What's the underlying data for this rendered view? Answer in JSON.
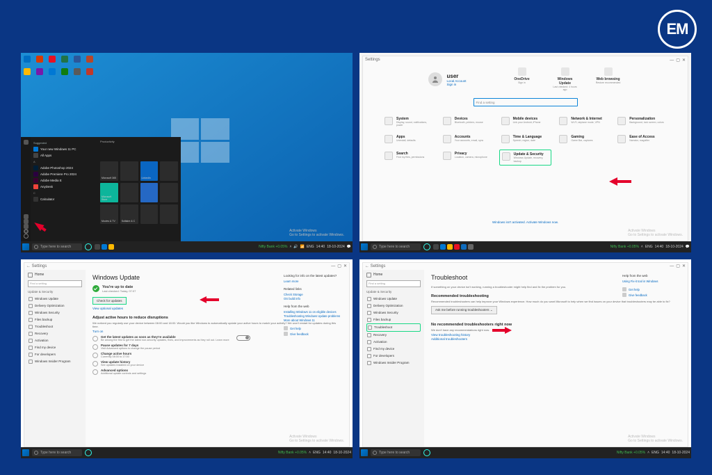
{
  "brand": "EM",
  "common": {
    "search_placeholder": "Type here to search",
    "activate_title": "Activate Windows",
    "activate_sub": "Go to Settings to activate Windows.",
    "clock": "14:40",
    "date": "18-10-2024",
    "stock": "Nifty Bank +0.05%"
  },
  "p1": {
    "desktop_icons": [
      "#006fc4",
      "#d83b01",
      "#e81123",
      "#217346",
      "#2b579a",
      "#b7472a",
      "#ffb900",
      "#7719aa",
      "#0078d4",
      "#107c10",
      "#5a5a5a",
      "#c0392b"
    ],
    "start": {
      "header": "Suggested",
      "header2": "Productivity",
      "suggested": "Your new Windows 11 PC",
      "apps": [
        {
          "name": "All Apps",
          "color": "#444"
        },
        {
          "name": "Adobe Photoshop 2024",
          "color": "#001e36"
        },
        {
          "name": "Adobe Premiere Pro 2024",
          "color": "#2a003f"
        },
        {
          "name": "Adobe Media E",
          "color": "#3a0030"
        },
        {
          "name": "AnyDesk",
          "color": "#ef443b"
        },
        {
          "name": "Calculator",
          "color": "#333"
        }
      ],
      "tiles": [
        "Microsoft 365",
        "",
        "",
        "",
        "Microsoft Store",
        "",
        "",
        "LinkedIn",
        "",
        "",
        "",
        "Movies & TV",
        "Solitaire & C",
        ""
      ]
    }
  },
  "p2": {
    "title": "Settings",
    "user": {
      "name": "user",
      "sub": "Local Account",
      "link": "Sign in"
    },
    "quick": [
      {
        "label": "OneDrive",
        "sub": "Sign in"
      },
      {
        "label": "Windows Update",
        "sub": "Last checked: 4 hours ago"
      },
      {
        "label": "Web browsing",
        "sub": "Restore recommended"
      }
    ],
    "search": "Find a setting",
    "cats": [
      {
        "t": "System",
        "s": "Display, sound, notifications, power"
      },
      {
        "t": "Devices",
        "s": "Bluetooth, printers, mouse"
      },
      {
        "t": "Mobile devices",
        "s": "Link your Android, iPhone"
      },
      {
        "t": "Network & Internet",
        "s": "Wi-Fi, airplane mode, VPN"
      },
      {
        "t": "Personalization",
        "s": "Background, lock screen, colors"
      },
      {
        "t": "Apps",
        "s": "Uninstall, defaults"
      },
      {
        "t": "Accounts",
        "s": "Your accounts, email, sync"
      },
      {
        "t": "Time & Language",
        "s": "Speech, region, date"
      },
      {
        "t": "Gaming",
        "s": "Game Bar, captures"
      },
      {
        "t": "Ease of Access",
        "s": "Narrator, magnifier"
      },
      {
        "t": "Search",
        "s": "Find my files, permissions"
      },
      {
        "t": "Privacy",
        "s": "Location, camera, microphone"
      },
      {
        "t": "Update & Security",
        "s": "Windows Update, recovery, backup",
        "hi": true
      }
    ],
    "footer": "Windows isn't activated. Activate Windows now."
  },
  "p3": {
    "title": "Settings",
    "home": "Home",
    "search": "Find a setting",
    "group": "Update & Security",
    "side": [
      "Windows Update",
      "Delivery Optimization",
      "Windows Security",
      "Files backup",
      "Troubleshoot",
      "Recovery",
      "Activation",
      "Find my device",
      "For developers",
      "Windows Insider Program"
    ],
    "h2": "Windows Update",
    "status_b": "You're up to date",
    "status_c": "Last checked: Today, 07:07",
    "btn": "Check for updates",
    "link1": "View optional updates",
    "sect": "Adjust active hours to reduce disruptions",
    "para": "We noticed you regularly use your device between 08:00 and 18:00. Would you like Windows to automatically update your active hours to match your activity? We won't restart for updates during this time.",
    "turn": "Turn on",
    "rows": [
      {
        "t": "Get the latest updates as soon as they're available",
        "s": "Be among the first to get the latest non-security updates, fixes, and improvements as they roll out. Learn more"
      },
      {
        "t": "Pause updates for 7 days",
        "s": "Visit Advanced options to change the pause period"
      },
      {
        "t": "Change active hours",
        "s": "Currently 08:00 to 17:00"
      },
      {
        "t": "View update history",
        "s": "See updates installed on your device"
      },
      {
        "t": "Advanced options",
        "s": "Additional update controls and settings"
      }
    ],
    "aside": {
      "t1": "Looking for info on the latest updates?",
      "l1": "Learn more",
      "t2": "Related links",
      "l2": "Check Storage",
      "l3": "OS build info",
      "t3": "Help from the web",
      "l4": "Installing Windows 11 on eligible devices",
      "l5": "Troubleshooting Windows Update problems",
      "l6": "More about Windows 11",
      "gh": "Get help",
      "fb": "Give feedback"
    }
  },
  "p4": {
    "title": "Settings",
    "home": "Home",
    "search": "Find a setting",
    "group": "Update & Security",
    "side": [
      "Windows Update",
      "Delivery Optimization",
      "Windows Security",
      "Files backup",
      "Troubleshoot",
      "Recovery",
      "Activation",
      "Find my device",
      "For developers",
      "Windows Insider Program"
    ],
    "side_hi": 4,
    "h2": "Troubleshoot",
    "intro": "If something on your device isn't working, running a troubleshooter might help find and fix the problem for you.",
    "sect1": "Recommended troubleshooting",
    "para1": "Recommended troubleshooters can help improve your Windows experience. How much do you want Microsoft to help when we find issues on your device that troubleshooters may be able to fix?",
    "dropdown": "Ask me before running troubleshooters",
    "sect2": "No recommended troubleshooters right now",
    "para2": "We don't have any recommendations right now.",
    "link1": "View troubleshooting history",
    "link2": "Additional troubleshooters",
    "aside": {
      "t1": "Help from the web",
      "l1": "Using Fix-it tool in Windows",
      "gh": "Get help",
      "fb": "Give feedback"
    }
  }
}
